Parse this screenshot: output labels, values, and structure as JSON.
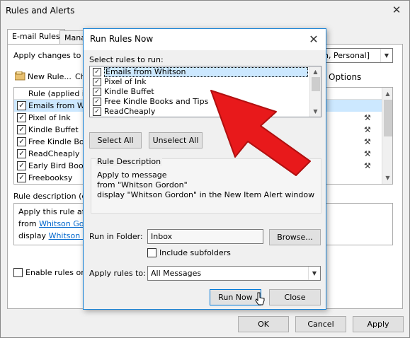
{
  "outer": {
    "title": "Rules and Alerts",
    "tabs": [
      "E-mail Rules",
      "Mana"
    ],
    "apply_changes_label": "Apply changes to th",
    "folder_combo_value": "n, Personal]",
    "new_rule_label": "New Rule...",
    "ch_label": "Ch",
    "options_label": "Options",
    "column_header": "Rule (applied in t",
    "rules": [
      "Emails from Whit",
      "Pixel of Ink",
      "Kindle Buffet",
      "Free Kindle Book",
      "ReadCheaply",
      "Early Bird Books",
      "Freebooksy"
    ],
    "rule_description_label": "Rule description (cli",
    "description": {
      "line1": "Apply this rule aft",
      "line2_prefix": "from ",
      "line2_link": "Whitson Gord",
      "line3_prefix": "display ",
      "line3_link": "Whitson Go"
    },
    "enable_rules_label": "Enable rules on",
    "ok": "OK",
    "cancel": "Cancel",
    "apply": "Apply"
  },
  "dialog": {
    "title": "Run Rules Now",
    "select_rules_label": "Select rules to run:",
    "rules": [
      "Emails from Whitson",
      "Pixel of Ink",
      "Kindle Buffet",
      "Free Kindle Books and Tips",
      "ReadCheaply"
    ],
    "select_all": "Select All",
    "unselect_all": "Unselect All",
    "rule_description_heading": "Rule Description",
    "desc_line1": "Apply to message",
    "desc_line2": "from \"Whitson Gordon\"",
    "desc_line3": "display \"Whitson Gordon\" in the New Item Alert window",
    "run_in_folder_label": "Run in Folder:",
    "folder_value": "Inbox",
    "browse": "Browse...",
    "include_subfolders": "Include subfolders",
    "apply_rules_to_label": "Apply rules to:",
    "apply_rules_to_value": "All Messages",
    "run_now": "Run Now",
    "close": "Close"
  },
  "colors": {
    "accent": "#1883d7",
    "arrow": "#e8191b"
  }
}
